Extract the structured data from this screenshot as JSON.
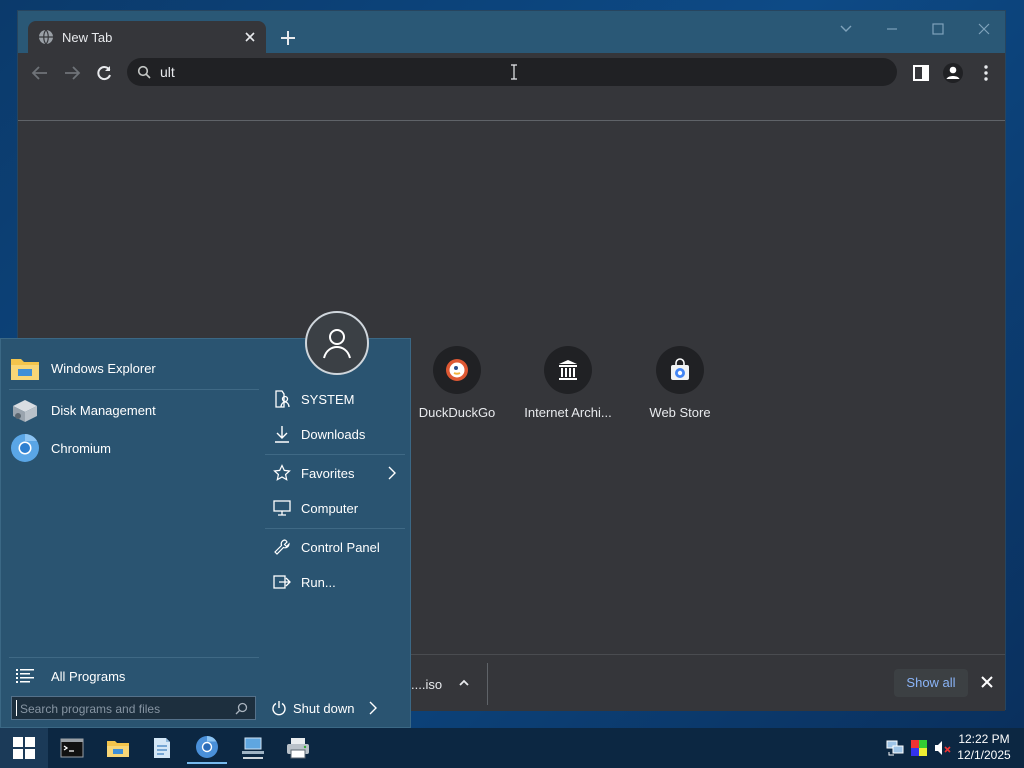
{
  "browser": {
    "tab_title": "New Tab",
    "omnibox_value": "ult",
    "shortcuts": [
      {
        "label": "DuckDuckGo",
        "icon": "duckduckgo-icon"
      },
      {
        "label": "Internet Archi...",
        "icon": "internet-archive-icon"
      },
      {
        "label": "Web Store",
        "icon": "web-store-icon"
      }
    ],
    "download": {
      "file": "....iso",
      "show_all": "Show all"
    }
  },
  "start_menu": {
    "pinned": [
      {
        "label": "Windows Explorer",
        "icon": "folder-icon"
      },
      {
        "label": "Disk Management",
        "icon": "disk-management-icon"
      },
      {
        "label": "Chromium",
        "icon": "chromium-icon"
      }
    ],
    "all_programs": "All Programs",
    "search_placeholder": "Search programs and files",
    "places": [
      {
        "label": "SYSTEM",
        "icon": "user-folder-icon"
      },
      {
        "label": "Downloads",
        "icon": "download-icon"
      },
      {
        "label": "Favorites",
        "icon": "star-icon"
      },
      {
        "label": "Computer",
        "icon": "monitor-icon"
      },
      {
        "label": "Control Panel",
        "icon": "wrench-icon"
      },
      {
        "label": "Run...",
        "icon": "run-icon"
      }
    ],
    "shutdown": "Shut down"
  },
  "taskbar": {
    "time": "12:22 PM",
    "date": "12/1/2025",
    "apps": [
      "command-prompt-icon",
      "file-explorer-icon",
      "notepad-icon",
      "chromium-icon",
      "network-pc-icon",
      "printer-icon"
    ]
  },
  "colors": {
    "accent": "#2a5471",
    "taskbar": "#0c2742",
    "link": "#8ab4f8"
  }
}
